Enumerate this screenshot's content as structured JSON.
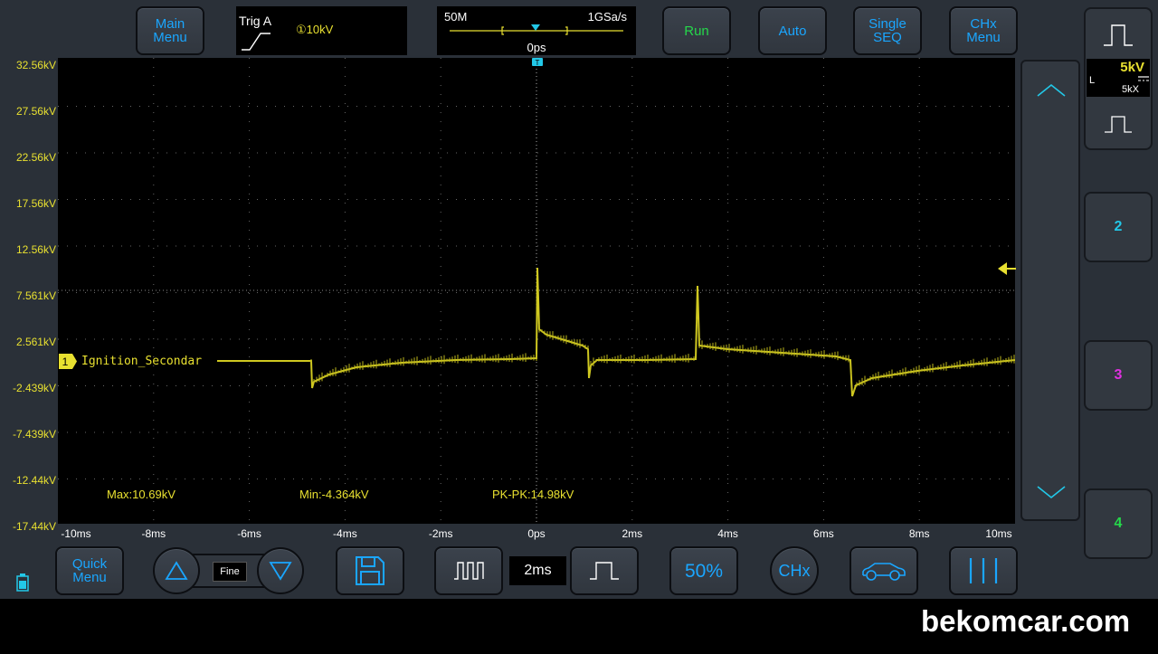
{
  "top_bar": {
    "main_menu": "Main\nMenu",
    "run": "Run",
    "auto": "Auto",
    "single_seq": "Single\nSEQ",
    "chx_menu": "CHx\nMenu"
  },
  "trigger": {
    "title": "Trig A",
    "level": "①10kV"
  },
  "timebase_info": {
    "memory_depth": "50M",
    "sample_rate": "1GSa/s",
    "offset": "0ps"
  },
  "channel1": {
    "marker": "1",
    "name": "Ignition_Secondar",
    "volts_per_div": "5kV",
    "coupling": "L",
    "probe": "5kX",
    "color": "#e8e030"
  },
  "channel_buttons": [
    "2",
    "3",
    "4"
  ],
  "channel_colors": {
    "ch2": "#22c8e8",
    "ch3": "#e030e0",
    "ch4": "#25d84a"
  },
  "y_axis_labels": [
    "32.56kV",
    "27.56kV",
    "22.56kV",
    "17.56kV",
    "12.56kV",
    "7.561kV",
    "2.561kV",
    "-2.439kV",
    "-7.439kV",
    "-12.44kV",
    "-17.44kV"
  ],
  "x_axis_labels": [
    "-10ms",
    "-8ms",
    "-6ms",
    "-4ms",
    "-2ms",
    "0ps",
    "2ms",
    "4ms",
    "6ms",
    "8ms",
    "10ms"
  ],
  "measurements": {
    "max": "Max:10.69kV",
    "min": "Min:-4.364kV",
    "pkpk": "PK-PK:14.98kV"
  },
  "bottom_bar": {
    "quick_menu": "Quick\nMenu",
    "fine": "Fine",
    "timebase": "2ms",
    "fifty_percent": "50%",
    "chx": "CHx"
  },
  "icons": [
    "battery-icon",
    "up-triangle-icon",
    "down-triangle-icon",
    "save-disk-icon",
    "pulse-train-icon",
    "single-pulse-icon",
    "car-icon",
    "cursor-lines-icon",
    "chevron-up-icon",
    "chevron-down-icon",
    "trigger-edge-icon",
    "trigger-level-arrow-icon"
  ],
  "watermark": "bekomcar.com"
}
